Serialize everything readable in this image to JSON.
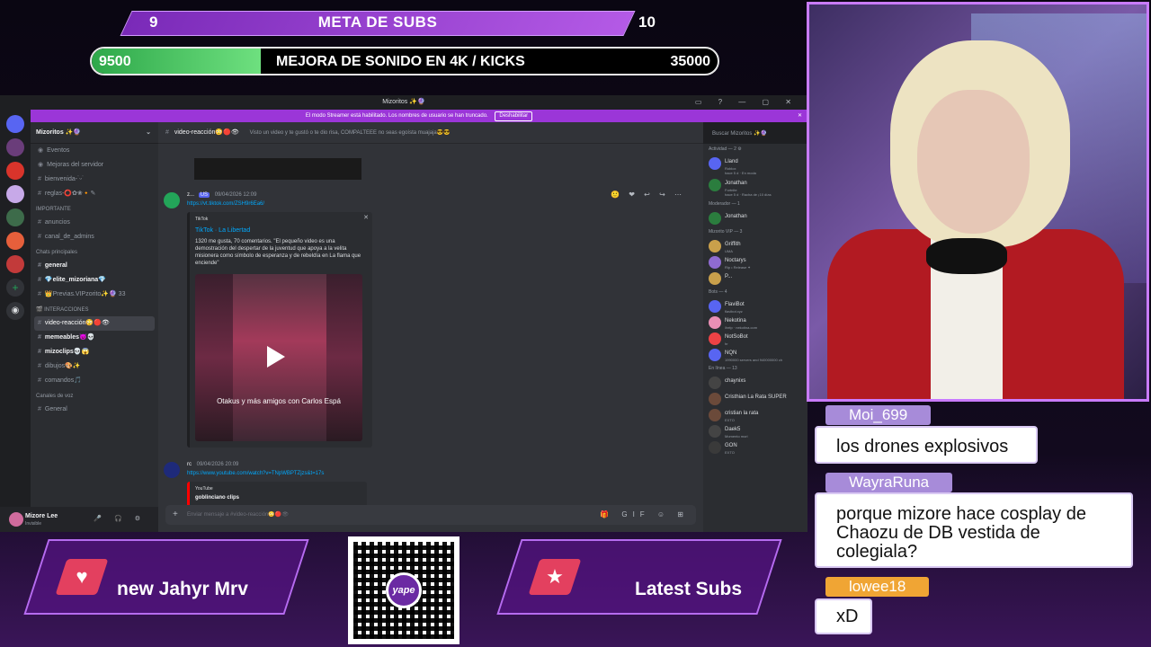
{
  "overlay": {
    "goal1": {
      "start": "9",
      "title": "META DE SUBS",
      "end": "10",
      "progress": 0.0
    },
    "goal2": {
      "start": "9500",
      "title": "MEJORA DE SONIDO EN 4K / KICKS",
      "end": "35000",
      "progress": 0.27
    }
  },
  "discord": {
    "window_title": "Mizoritos ✨🔮",
    "banner": {
      "text": "El modo Streamer está habilitado. Los nombres de usuario se han truncado.",
      "button": "Deshabilitar"
    },
    "server_name": "Mizoritos ✨🔮",
    "channels": [
      {
        "type": "item",
        "label": "Eventos"
      },
      {
        "type": "item",
        "label": "Mejoras del servidor"
      },
      {
        "type": "channel",
        "label": "bienvenida-˙ᵕ˙"
      },
      {
        "type": "channel",
        "label": "reglas-⭕✿❀🔸✎"
      },
      {
        "type": "category",
        "label": "IMPORTANTE"
      },
      {
        "type": "channel",
        "label": "anuncios"
      },
      {
        "type": "channel",
        "label": "canal_de_admins"
      },
      {
        "type": "category",
        "label": "Chats principales"
      },
      {
        "type": "channel",
        "label": "general",
        "bold": true
      },
      {
        "type": "channel",
        "label": "💎elite_mizoriana💎",
        "bold": true
      },
      {
        "type": "channel",
        "label": "👑Previas.VIPzorito✨🔮 33"
      },
      {
        "type": "category",
        "label": "🎬 INTERACCIONES"
      },
      {
        "type": "channel",
        "label": "video-reacción😳🔴👁",
        "active": true
      },
      {
        "type": "channel",
        "label": "memeables😈💀",
        "bold": true
      },
      {
        "type": "channel",
        "label": "mizoclips💀😱",
        "bold": true
      },
      {
        "type": "channel",
        "label": "dibujos🎨✨"
      },
      {
        "type": "channel",
        "label": "comandos🎵"
      },
      {
        "type": "category",
        "label": "Canales de voz"
      },
      {
        "type": "channel",
        "label": "General"
      }
    ],
    "user": {
      "name": "Mizore Lee",
      "status": "Invisible"
    },
    "channel_header": {
      "name": "video-reacción😳🔴👁",
      "topic": "Visto un video y te gustó o te dio risa, COMPALTEEE no seas egoísta muajaja😎😎"
    },
    "search_placeholder": "Buscar Mizoritos ✨🔮",
    "messages": [
      {
        "author": "z...",
        "tag": "US",
        "time": "09/04/2026 12:09",
        "link": "https://vt.tiktok.com/ZSH9r6Ea6/",
        "embed": {
          "provider": "TikTok",
          "title": "TikTok · La Libertad",
          "description": "1320 me gusta, 70 comentarios. \"El pequeño video es una demostración del despertar de la juventud que apoya a la velita misionera como símbolo de esperanza y de rebeldía en La flama que enciende\"",
          "video_caption": "Otakus y más amigos con Carlos Espá"
        }
      },
      {
        "author": "rc",
        "time": "09/04/2026 20:09",
        "link": "https://www.youtube.com/watch?v=TNpWBPTZjzs&t=17s",
        "embed": {
          "provider": "YouTube",
          "title": "goblinciano clips"
        }
      }
    ],
    "input_placeholder": "Enviar mensaje a #video-reacción😳🔴👁",
    "members": [
      {
        "type": "category",
        "label": "Actividad — 2 ⚙"
      },
      {
        "type": "member",
        "name": "Lland",
        "status": "Roblox",
        "sub": "hace 5 d · En moda",
        "color": "#5865f2"
      },
      {
        "type": "member",
        "name": "Jonathan",
        "status": "Fortnite",
        "sub": "hace 5 d · Racha de ¡10 días",
        "color": "#2b7d3e"
      },
      {
        "type": "category",
        "label": "Moderador — 1"
      },
      {
        "type": "member",
        "name": "Jonathan",
        "status": "",
        "color": "#2b7d3e"
      },
      {
        "type": "category",
        "label": "Mizorito VIP — 3"
      },
      {
        "type": "member",
        "name": "Griffith",
        "status": "UMA",
        "color": "#c9a04b"
      },
      {
        "type": "member",
        "name": "Noctarys",
        "status": "Rip • Release ✦",
        "color": "#8f6bd1"
      },
      {
        "type": "member",
        "name": "P...",
        "status": "",
        "color": "#c9a04b"
      },
      {
        "type": "category",
        "label": "Bots — 4"
      },
      {
        "type": "member",
        "name": "FlaviBot",
        "status": "flavibot.xyz",
        "color": "#5865f2"
      },
      {
        "type": "member",
        "name": "Nekotina",
        "status": "/help · nekotina.com",
        "color": "#e98fb5"
      },
      {
        "type": "member",
        "name": "NotSoBot",
        "status": "hr",
        "color": "#ed4245"
      },
      {
        "type": "member",
        "name": "NQN",
        "status": "1990000 servers and 940000000 ch",
        "color": "#5865f2"
      },
      {
        "type": "category",
        "label": "En línea — 13"
      },
      {
        "type": "member",
        "name": "chaynixs",
        "status": "",
        "color": "#444"
      },
      {
        "type": "member",
        "name": "Cristhian La Rata SUPER",
        "status": "",
        "color": "#6b4a3a"
      },
      {
        "type": "member",
        "name": "cristian la rata",
        "status": "EXTO",
        "color": "#6b4a3a"
      },
      {
        "type": "member",
        "name": "Daek5",
        "status": "Momento mori",
        "color": "#444"
      },
      {
        "type": "member",
        "name": "GON",
        "status": "EXTO",
        "color": "#3a3a3a"
      }
    ]
  },
  "stream_chat": [
    {
      "user": "Moi_699",
      "text": "los drones explosivos"
    },
    {
      "user": "WayraRuna",
      "text": "porque mizore hace cosplay de Chaozu de DB vestida de colegiala?"
    },
    {
      "user": "lowee18",
      "text": "xD"
    }
  ],
  "bottom": {
    "ticker_left": "new  Jahyr  Mrv",
    "ticker_right": "Latest Subs",
    "qr_label": "yape",
    "colors": {
      "accent": "#b66cf0",
      "pink": "#e3405f"
    }
  }
}
